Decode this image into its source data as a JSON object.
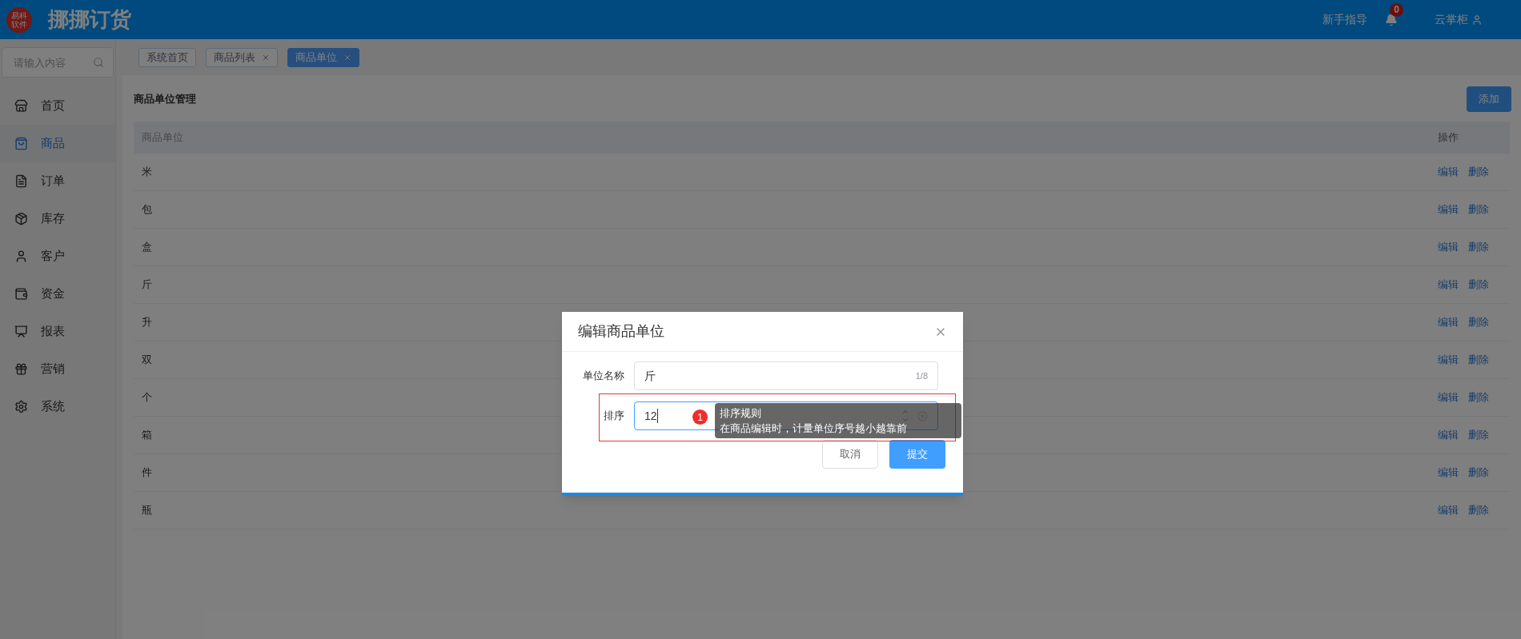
{
  "header": {
    "logo": "易科软件",
    "app_title": "挪挪订货",
    "guide_link": "新手指导",
    "notification_count": "0",
    "user": "云掌柜"
  },
  "sidebar": {
    "search": {
      "placeholder": "请输入内容"
    },
    "items": [
      {
        "label": "首页",
        "selected": false
      },
      {
        "label": "商品",
        "selected": true
      },
      {
        "label": "订单",
        "selected": false
      },
      {
        "label": "库存",
        "selected": false
      },
      {
        "label": "客户",
        "selected": false
      },
      {
        "label": "资金",
        "selected": false
      },
      {
        "label": "报表",
        "selected": false
      },
      {
        "label": "营销",
        "selected": false
      },
      {
        "label": "系统",
        "selected": false
      }
    ]
  },
  "tabs": [
    {
      "label": "系统首页",
      "selected": false,
      "closable": false
    },
    {
      "label": "商品列表",
      "selected": false,
      "closable": true
    },
    {
      "label": "商品单位",
      "selected": true,
      "closable": true
    }
  ],
  "panel": {
    "title": "商品单位管理",
    "add_button": "添加"
  },
  "table": {
    "columns": [
      "商品单位",
      "操作"
    ],
    "rows": [
      {
        "unit": "米",
        "actions": [
          "编辑",
          "删除"
        ]
      },
      {
        "unit": "包",
        "actions": [
          "编辑",
          "删除"
        ]
      },
      {
        "unit": "盒",
        "actions": [
          "编辑",
          "删除"
        ]
      },
      {
        "unit": "斤",
        "actions": [
          "编辑",
          "删除"
        ]
      },
      {
        "unit": "升",
        "actions": [
          "编辑",
          "删除"
        ]
      },
      {
        "unit": "双",
        "actions": [
          "编辑",
          "删除"
        ]
      },
      {
        "unit": "个",
        "actions": [
          "编辑",
          "删除"
        ]
      },
      {
        "unit": "箱",
        "actions": [
          "编辑",
          "删除"
        ]
      },
      {
        "unit": "件",
        "actions": [
          "编辑",
          "删除"
        ]
      },
      {
        "unit": "瓶",
        "actions": [
          "编辑",
          "删除"
        ]
      }
    ]
  },
  "dialog": {
    "title": "编辑商品单位",
    "fields": [
      {
        "label": "单位名称",
        "value": "斤",
        "counter": "1/8",
        "kind": "text"
      },
      {
        "label": "排序",
        "value": "12",
        "kind": "number"
      }
    ],
    "buttons": [
      {
        "label": "取消",
        "primary": false
      },
      {
        "label": "提交",
        "primary": true
      }
    ]
  },
  "guide": {
    "step": "1",
    "title": "排序规则",
    "text": "在商品编辑时，计量单位序号越小越靠前"
  }
}
